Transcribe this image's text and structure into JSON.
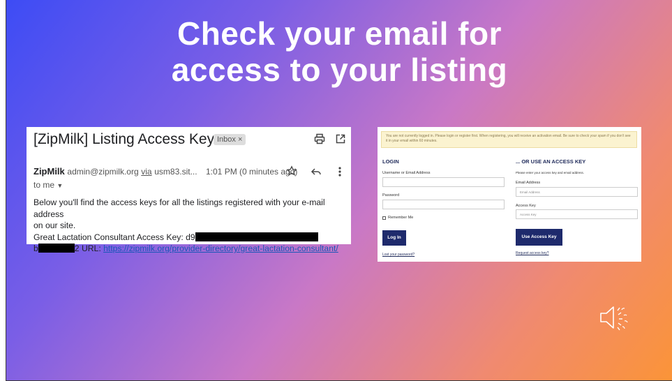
{
  "slide": {
    "title_line1": "Check your email for",
    "title_line2": "access to your listing"
  },
  "email": {
    "subject": "[ZipMilk] Listing Access Keys",
    "badge": "Inbox ×",
    "icons": [
      "print-icon",
      "open-in-new-icon",
      "star-icon",
      "reply-icon",
      "more-vert-icon"
    ],
    "sender_name": "ZipMilk",
    "sender_address": "admin@zipmilk.org",
    "via_label": "via",
    "via_server": "usm83.sit...",
    "time": "1:01 PM (0 minutes ago)",
    "to": "to me",
    "body_line1": "Below you'll find the access keys for all the listings registered with your e-mail address",
    "body_line2": "on our site.",
    "body_line3_prefix": "Great Lactation Consultant Access Key: d9",
    "body_line4_prefix": "b",
    "body_line4_mid": "2 URL: ",
    "url": "https://zipmilk.org/provider-directory/great-lactation-consultant/"
  },
  "login": {
    "notice": "You are not currently logged in. Please login or register first. When registering, you will receive an activation email. Be sure to check your spam if you don't see it in your email within 60 minutes.",
    "login_heading": "LOGIN",
    "username_label": "Username or Email Address",
    "password_label": "Password",
    "remember_label": "Remember Me",
    "login_button": "Log In",
    "lost_password": "Lost your password?",
    "key_heading": "... OR USE AN ACCESS KEY",
    "key_instructions": "Please enter your access key and email address.",
    "email_label": "Email Address",
    "email_placeholder": "Email Address",
    "key_label": "Access Key",
    "key_placeholder": "Access Key",
    "use_key_button": "Use Access Key",
    "request_key": "Request access key?"
  },
  "colors": {
    "gradient_start": "#3d4cf5",
    "gradient_end": "#fb9438",
    "button_navy": "#1e2a6c",
    "link_blue": "#1a57b8"
  }
}
